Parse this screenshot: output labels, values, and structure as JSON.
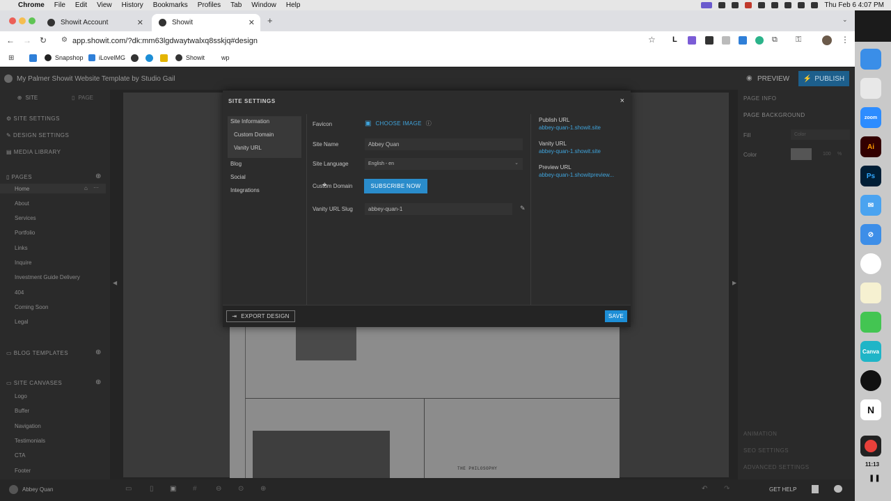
{
  "menubar": {
    "app_name": "Chrome",
    "menus": [
      "File",
      "Edit",
      "View",
      "History",
      "Bookmarks",
      "Profiles",
      "Tab",
      "Window",
      "Help"
    ],
    "clock": "Thu Feb 6  4:07 PM"
  },
  "browser": {
    "tabs": [
      {
        "title": "Showit Account",
        "active": false
      },
      {
        "title": "Showit",
        "active": true
      }
    ],
    "new_tab": "+",
    "url": "app.showit.com/?dk:mm63lgdwaytwalxq8sskjq#design",
    "bookmarks": [
      "Snapshop",
      "iLovelMG",
      "Showit",
      "wp"
    ]
  },
  "app": {
    "site_title": "My Palmer Showit Website Template by Studio Gail",
    "preview_label": "PREVIEW",
    "publish_label": "PUBLISH",
    "left_tabs": [
      "SITE",
      "PAGE"
    ],
    "site_settings_label": "SITE SETTINGS",
    "design_settings_label": "DESIGN SETTINGS",
    "media_library_label": "MEDIA LIBRARY",
    "pages_label": "PAGES",
    "pages": [
      "Home",
      "About",
      "Services",
      "Portfolio",
      "Links",
      "Inquire",
      "Investment Guide Delivery",
      "404",
      "Coming Soon",
      "Legal"
    ],
    "blog_templates_label": "BLOG TEMPLATES",
    "site_canvases_label": "SITE CANVASES",
    "canvases": [
      "Logo",
      "Buffer",
      "Navigation",
      "Testimonials",
      "CTA",
      "Footer"
    ],
    "user_name": "Abbey Quan",
    "right_panel": {
      "page_info": "PAGE INFO",
      "page_background": "PAGE BACKGROUND",
      "fill_label": "Fill",
      "fill_value": "Color",
      "color_label": "Color",
      "opacity_value": "100",
      "opacity_unit": "%",
      "animation": "ANIMATION",
      "seo_settings": "SEO SETTINGS",
      "advanced_settings": "ADVANCED SETTINGS"
    },
    "get_help_label": "GET HELP",
    "canvas_text": "THE PHILOSOPHY"
  },
  "modal": {
    "title": "SITE SETTINGS",
    "close": "×",
    "nav": {
      "site_information": "Site Information",
      "custom_domain": "Custom Domain",
      "vanity_url": "Vanity URL",
      "blog": "Blog",
      "social": "Social",
      "integrations": "Integrations"
    },
    "fields": {
      "favicon_label": "Favicon",
      "choose_image": "CHOOSE IMAGE",
      "site_name_label": "Site Name",
      "site_name_value": "Abbey Quan",
      "site_language_label": "Site Language",
      "site_language_value": "English - en",
      "custom_domain_label": "Custom Domain",
      "subscribe_label": "SUBSCRIBE NOW",
      "vanity_slug_label": "Vanity URL Slug",
      "vanity_slug_value": "abbey-quan-1"
    },
    "urls": {
      "publish_label": "Publish URL",
      "publish_value": "abbey-quan-1.showit.site",
      "vanity_label": "Vanity URL",
      "vanity_value": "abbey-quan-1.showit.site",
      "preview_label": "Preview URL",
      "preview_value": "abbey-quan-1.showitpreview..."
    },
    "export_label": "EXPORT DESIGN",
    "save_label": "SAVE"
  },
  "dock": {
    "recording_time": "11:13"
  },
  "colors": {
    "accent": "#2a8ccb",
    "link": "#3fa4dc",
    "modal_bg": "#2c2c2c"
  }
}
